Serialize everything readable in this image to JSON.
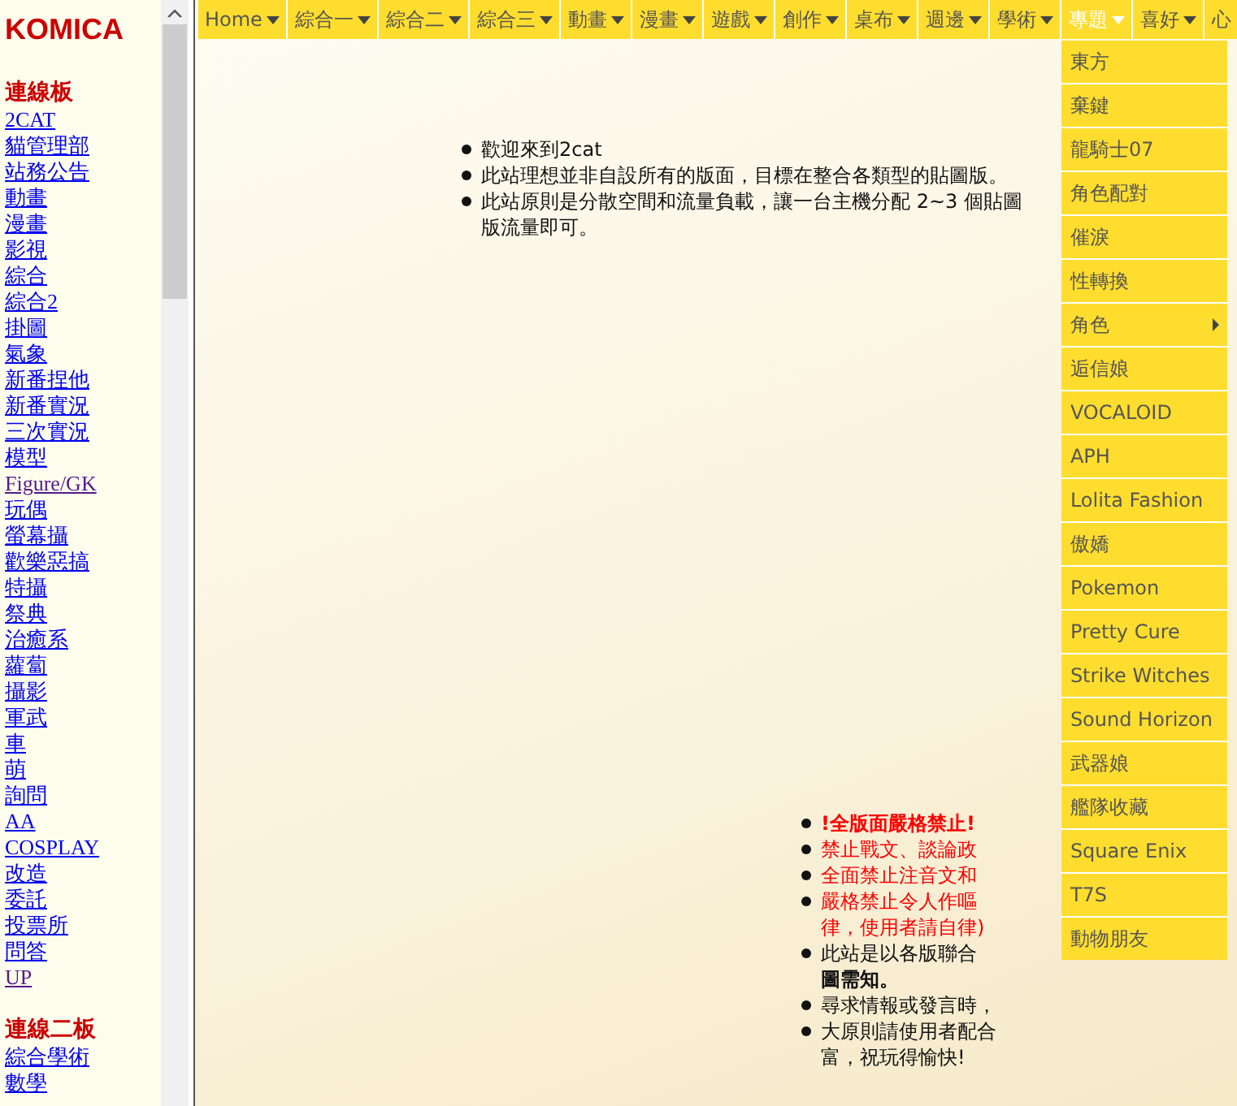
{
  "sidebar": {
    "logo": "KOMICA",
    "sections": [
      {
        "heading": "連線板",
        "links": [
          {
            "label": "2CAT",
            "visited": false
          },
          {
            "label": "貓管理部",
            "visited": false
          },
          {
            "label": "站務公告",
            "visited": false
          },
          {
            "label": "動畫",
            "visited": false
          },
          {
            "label": "漫畫",
            "visited": false
          },
          {
            "label": "影視",
            "visited": false
          },
          {
            "label": "綜合",
            "visited": false
          },
          {
            "label": "綜合2",
            "visited": false
          },
          {
            "label": "掛圖",
            "visited": false
          },
          {
            "label": "氣象",
            "visited": false
          },
          {
            "label": "新番捏他",
            "visited": false
          },
          {
            "label": "新番實況",
            "visited": false
          },
          {
            "label": "三次實況",
            "visited": false
          },
          {
            "label": "模型",
            "visited": false
          },
          {
            "label": "Figure/GK",
            "visited": true
          },
          {
            "label": "玩偶",
            "visited": false
          },
          {
            "label": "螢幕攝",
            "visited": false
          },
          {
            "label": "歡樂惡搞",
            "visited": false
          },
          {
            "label": "特攝",
            "visited": false
          },
          {
            "label": "祭典",
            "visited": false
          },
          {
            "label": "治癒系",
            "visited": false
          },
          {
            "label": "蘿蔔",
            "visited": false
          },
          {
            "label": "攝影",
            "visited": false
          },
          {
            "label": "軍武",
            "visited": false
          },
          {
            "label": "車",
            "visited": false
          },
          {
            "label": "萌",
            "visited": false
          },
          {
            "label": "詢問",
            "visited": false
          },
          {
            "label": "AA",
            "visited": false
          },
          {
            "label": "COSPLAY",
            "visited": false
          },
          {
            "label": "改造",
            "visited": false
          },
          {
            "label": "委託",
            "visited": false
          },
          {
            "label": "投票所",
            "visited": false
          },
          {
            "label": "問答",
            "visited": false
          },
          {
            "label": "UP",
            "visited": true
          }
        ]
      },
      {
        "heading": "連線二板",
        "links": [
          {
            "label": "綜合學術",
            "visited": false
          },
          {
            "label": "數學",
            "visited": false
          }
        ]
      }
    ]
  },
  "nav": {
    "items": [
      {
        "label": "Home",
        "caret": true,
        "selected": false
      },
      {
        "label": "綜合一",
        "caret": true,
        "selected": false
      },
      {
        "label": "綜合二",
        "caret": true,
        "selected": false
      },
      {
        "label": "綜合三",
        "caret": true,
        "selected": false
      },
      {
        "label": "動畫",
        "caret": true,
        "selected": false
      },
      {
        "label": "漫畫",
        "caret": true,
        "selected": false
      },
      {
        "label": "遊戲",
        "caret": true,
        "selected": false
      },
      {
        "label": "創作",
        "caret": true,
        "selected": false
      },
      {
        "label": "桌布",
        "caret": true,
        "selected": false
      },
      {
        "label": "週邊",
        "caret": true,
        "selected": false
      },
      {
        "label": "學術",
        "caret": true,
        "selected": false
      },
      {
        "label": "專題",
        "caret": true,
        "selected": true
      },
      {
        "label": "喜好",
        "caret": true,
        "selected": false
      },
      {
        "label": "心",
        "caret": false,
        "selected": false
      }
    ],
    "dropdown": {
      "items": [
        {
          "label": "東方",
          "has_submenu": false
        },
        {
          "label": "棄鍵",
          "has_submenu": false
        },
        {
          "label": "龍騎士07",
          "has_submenu": false
        },
        {
          "label": "角色配對",
          "has_submenu": false
        },
        {
          "label": "催淚",
          "has_submenu": false
        },
        {
          "label": "性轉換",
          "has_submenu": false
        },
        {
          "label": "角色",
          "has_submenu": true
        },
        {
          "label": "逅信娘",
          "has_submenu": false
        },
        {
          "label": "VOCALOID",
          "has_submenu": false
        },
        {
          "label": "APH",
          "has_submenu": false
        },
        {
          "label": "Lolita Fashion",
          "has_submenu": false
        },
        {
          "label": "傲嬌",
          "has_submenu": false
        },
        {
          "label": "Pokemon",
          "has_submenu": false
        },
        {
          "label": "Pretty Cure",
          "has_submenu": false
        },
        {
          "label": "Strike Witches",
          "has_submenu": false
        },
        {
          "label": "Sound Horizon",
          "has_submenu": false
        },
        {
          "label": "武器娘",
          "has_submenu": false
        },
        {
          "label": "艦隊收藏",
          "has_submenu": false
        },
        {
          "label": "Square Enix",
          "has_submenu": false
        },
        {
          "label": "T7S",
          "has_submenu": false
        },
        {
          "label": "動物朋友",
          "has_submenu": false
        }
      ]
    }
  },
  "notices": [
    "歡迎來到2cat",
    "此站理想並非自設所有的版面，目標在整合各類型的貼圖版。",
    "此站原則是分散空間和流量負載，讓一台主機分配 2~3 個貼圖版流量即可。"
  ],
  "rules": [
    {
      "lines": [
        {
          "text": "!全版面嚴格禁止!",
          "kind": "alert"
        }
      ]
    },
    {
      "lines": [
        {
          "text": "禁止戰文、談論政",
          "kind": "warning"
        }
      ]
    },
    {
      "lines": [
        {
          "text": "全面禁止注音文和",
          "kind": "warning"
        }
      ]
    },
    {
      "lines": [
        {
          "text": "嚴格禁止令人作嘔",
          "kind": "warning"
        },
        {
          "text": "律，使用者請自律)",
          "kind": "warning"
        }
      ]
    },
    {
      "lines": [
        {
          "text": "此站是以各版聯合",
          "kind": "plain"
        },
        {
          "text": "圖需知。",
          "kind": "strong"
        }
      ]
    },
    {
      "lines": [
        {
          "text": "尋求情報或發言時，",
          "kind": "plain"
        }
      ]
    },
    {
      "lines": [
        {
          "text": "大原則請使用者配合",
          "kind": "plain"
        },
        {
          "text": "富，祝玩得愉快!",
          "kind": "plain"
        }
      ]
    }
  ]
}
